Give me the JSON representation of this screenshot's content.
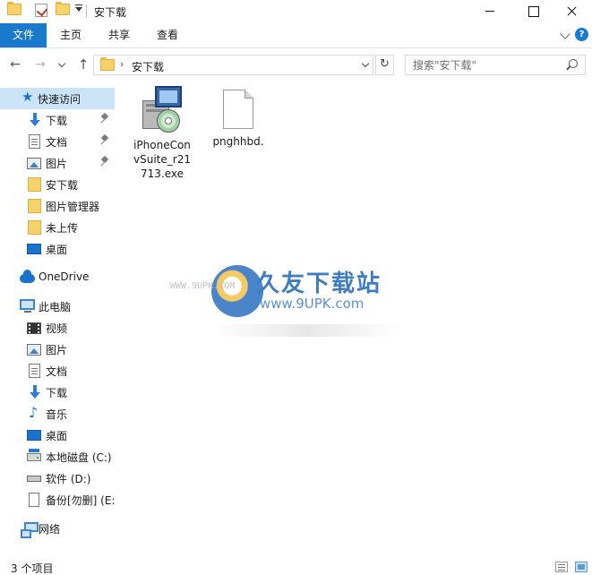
{
  "window": {
    "title": "安下载"
  },
  "quick_access_toolbar": {
    "icons": [
      "folder-icon",
      "properties-check-icon",
      "new-folder-icon",
      "customize-dropdown-icon"
    ]
  },
  "ribbon": {
    "tabs": [
      {
        "label": "文件",
        "active": true
      },
      {
        "label": "主页"
      },
      {
        "label": "共享"
      },
      {
        "label": "查看"
      }
    ]
  },
  "address_bar": {
    "path": "安下载",
    "separator": "›"
  },
  "search": {
    "placeholder": "搜索\"安下载\""
  },
  "nav_pane": {
    "quick_access": {
      "label": "快速访问",
      "items": [
        {
          "label": "下载",
          "icon": "download-icon",
          "pinned": true
        },
        {
          "label": "文档",
          "icon": "document-icon",
          "pinned": true
        },
        {
          "label": "图片",
          "icon": "picture-icon",
          "pinned": true
        },
        {
          "label": "安下载",
          "icon": "folder-icon"
        },
        {
          "label": "图片管理器",
          "icon": "folder-icon"
        },
        {
          "label": "未上传",
          "icon": "folder-icon"
        },
        {
          "label": "桌面",
          "icon": "desktop-icon"
        }
      ]
    },
    "onedrive": {
      "label": "OneDrive"
    },
    "this_pc": {
      "label": "此电脑",
      "items": [
        {
          "label": "视频",
          "icon": "video-icon"
        },
        {
          "label": "图片",
          "icon": "picture-icon"
        },
        {
          "label": "文档",
          "icon": "document-icon"
        },
        {
          "label": "下载",
          "icon": "download-icon"
        },
        {
          "label": "音乐",
          "icon": "music-icon"
        },
        {
          "label": "桌面",
          "icon": "desktop-icon"
        },
        {
          "label": "本地磁盘 (C:)",
          "icon": "local-disk-icon"
        },
        {
          "label": "软件 (D:)",
          "icon": "drive-icon"
        },
        {
          "label": "备份[勿删] (E:",
          "icon": "drive-icon"
        }
      ]
    },
    "network": {
      "label": "网络"
    }
  },
  "files": [
    {
      "name": "iPhoneConvSuite_r21713.exe",
      "name_lines": [
        "iPhoneCon",
        "vSuite_r21",
        "713.exe"
      ],
      "icon": "installer-icon"
    },
    {
      "name": "pnghhbd.",
      "name_lines": [
        "pnghhbd."
      ],
      "icon": "blank-file-icon"
    }
  ],
  "watermark": {
    "title": "久友下载站",
    "url": "www.9UPK.com",
    "url_small": "WWW.9UPK.COM"
  },
  "status_bar": {
    "item_count": "3 个项目"
  },
  "colors": {
    "accent": "#1979ca",
    "selection": "#cce4f7"
  }
}
